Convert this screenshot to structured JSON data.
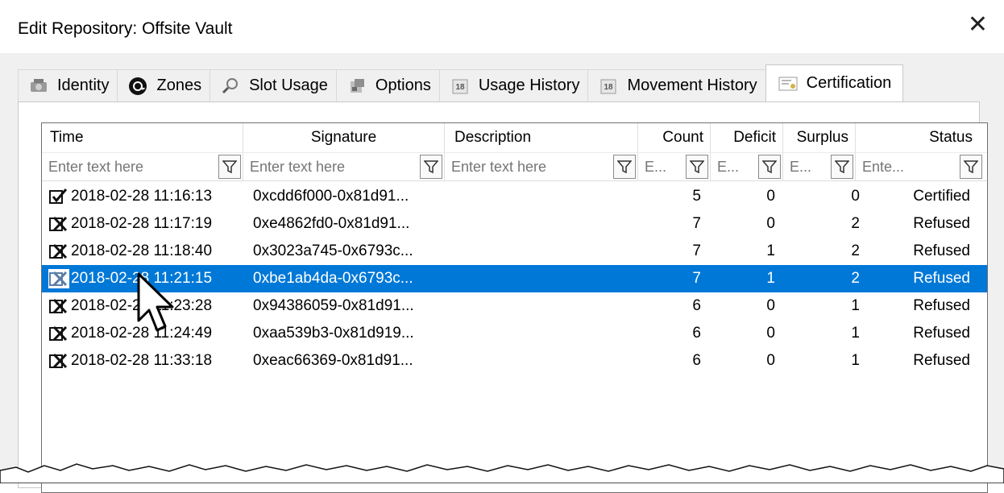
{
  "window": {
    "title": "Edit Repository: Offsite Vault",
    "close_label": "✕"
  },
  "tabs": [
    {
      "label": "Identity",
      "icon": "identity-icon"
    },
    {
      "label": "Zones",
      "icon": "at-icon"
    },
    {
      "label": "Slot Usage",
      "icon": "magnifier-icon"
    },
    {
      "label": "Options",
      "icon": "options-icon"
    },
    {
      "label": "Usage History",
      "icon": "calendar-icon"
    },
    {
      "label": "Movement History",
      "icon": "calendar-icon"
    },
    {
      "label": "Certification",
      "icon": "certificate-icon",
      "active": true
    }
  ],
  "grid": {
    "columns": [
      "Time",
      "Signature",
      "Description",
      "Count",
      "Deficit",
      "Surplus",
      "Status"
    ],
    "placeholders": [
      "Enter text here",
      "Enter text here",
      "Enter text here",
      "E...",
      "E...",
      "E...",
      "Ente..."
    ],
    "rows": [
      {
        "status_icon": "check-icon",
        "time": "2018-02-28 11:16:13",
        "signature": "0xcdd6f000-0x81d91...",
        "description": "",
        "count": "5",
        "deficit": "0",
        "surplus": "0",
        "status": "Certified"
      },
      {
        "status_icon": "refused-icon",
        "time": "2018-02-28 11:17:19",
        "signature": "0xe4862fd0-0x81d91...",
        "description": "",
        "count": "7",
        "deficit": "0",
        "surplus": "2",
        "status": "Refused"
      },
      {
        "status_icon": "refused-icon",
        "time": "2018-02-28 11:18:40",
        "signature": "0x3023a745-0x6793c...",
        "description": "",
        "count": "7",
        "deficit": "1",
        "surplus": "2",
        "status": "Refused"
      },
      {
        "status_icon": "refused-icon",
        "time": "2018-02-28 11:21:15",
        "signature": "0xbe1ab4da-0x6793c...",
        "description": "",
        "count": "7",
        "deficit": "1",
        "surplus": "2",
        "status": "Refused",
        "selected": true
      },
      {
        "status_icon": "refused-icon",
        "time": "2018-02-28 11:23:28",
        "signature": "0x94386059-0x81d91...",
        "description": "",
        "count": "6",
        "deficit": "0",
        "surplus": "1",
        "status": "Refused"
      },
      {
        "status_icon": "refused-icon",
        "time": "2018-02-28 11:24:49",
        "signature": "0xaa539b3-0x81d919...",
        "description": "",
        "count": "6",
        "deficit": "0",
        "surplus": "1",
        "status": "Refused"
      },
      {
        "status_icon": "refused-icon",
        "time": "2018-02-28 11:33:18",
        "signature": "0xeac66369-0x81d91...",
        "description": "",
        "count": "6",
        "deficit": "0",
        "surplus": "1",
        "status": "Refused"
      }
    ]
  },
  "colors": {
    "selection": "#0078d7",
    "background": "#f0f0f0"
  }
}
